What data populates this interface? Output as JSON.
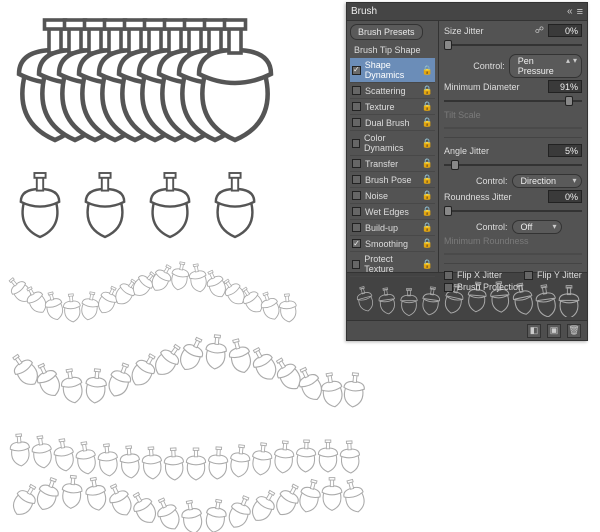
{
  "panel": {
    "title": "Brush",
    "brush_presets_label": "Brush Presets",
    "brush_tip_shape_label": "Brush Tip Shape",
    "options": [
      {
        "label": "Shape Dynamics",
        "checked": true,
        "selected": true
      },
      {
        "label": "Scattering",
        "checked": false
      },
      {
        "label": "Texture",
        "checked": false
      },
      {
        "label": "Dual Brush",
        "checked": false
      },
      {
        "label": "Color Dynamics",
        "checked": false
      },
      {
        "label": "Transfer",
        "checked": false
      },
      {
        "label": "Brush Pose",
        "checked": false
      },
      {
        "label": "Noise",
        "checked": false
      },
      {
        "label": "Wet Edges",
        "checked": false
      },
      {
        "label": "Build-up",
        "checked": false
      },
      {
        "label": "Smoothing",
        "checked": true
      },
      {
        "label": "Protect Texture",
        "checked": false
      }
    ],
    "size_jitter_label": "Size Jitter",
    "size_jitter_value": "0%",
    "control_label": "Control:",
    "size_control_value": "Pen Pressure",
    "min_diameter_label": "Minimum Diameter",
    "min_diameter_value": "91%",
    "tilt_scale_label": "Tilt Scale",
    "angle_jitter_label": "Angle Jitter",
    "angle_jitter_value": "5%",
    "angle_control_value": "Direction",
    "roundness_jitter_label": "Roundness Jitter",
    "roundness_jitter_value": "0%",
    "roundness_control_value": "Off",
    "min_roundness_label": "Minimum Roundness",
    "flip_x_label": "Flip X Jitter",
    "flip_y_label": "Flip Y Jitter",
    "brush_projection_label": "Brush Projection"
  }
}
